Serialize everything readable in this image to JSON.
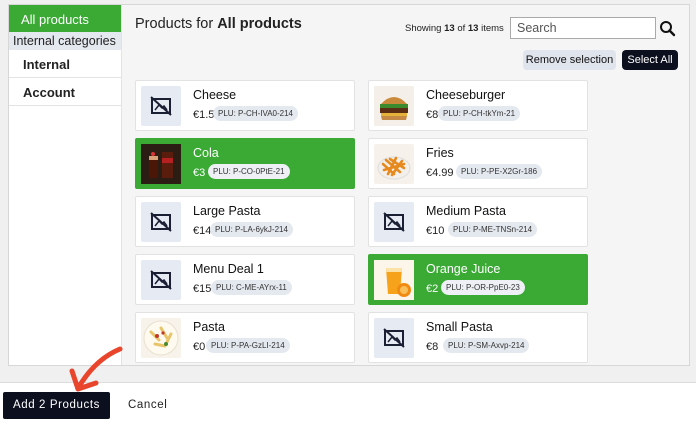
{
  "sidebar": {
    "all_products": "All products",
    "group_label": "Internal categories",
    "items": [
      {
        "label": "Internal"
      },
      {
        "label": "Account"
      }
    ]
  },
  "header": {
    "title_prefix": "Products for",
    "title_bold": "All products",
    "showing_prefix": "Showing",
    "showing_count": "13",
    "showing_of": "of",
    "showing_total": "13",
    "showing_suffix": "items",
    "search_placeholder": "Search",
    "remove_selection": "Remove selection",
    "select_all": "Select All"
  },
  "products": [
    {
      "name": "Cheese",
      "price": "€1.5",
      "plu": "PLU: P-CH-IVA0-214",
      "selected": false,
      "image": "no-image-icon"
    },
    {
      "name": "Cheeseburger",
      "price": "€8",
      "plu": "PLU: P-CH-tkYm-21",
      "selected": false,
      "image": "burger-photo"
    },
    {
      "name": "Cola",
      "price": "€3",
      "plu": "PLU: P-CO-0PtE-21",
      "selected": true,
      "image": "cola-photo"
    },
    {
      "name": "Fries",
      "price": "€4.99",
      "plu": "PLU: P-PE-X2Gr-186",
      "selected": false,
      "image": "fries-photo"
    },
    {
      "name": "Large Pasta",
      "price": "€14",
      "plu": "PLU: P-LA-6ykJ-214",
      "selected": false,
      "image": "no-image-icon"
    },
    {
      "name": "Medium Pasta",
      "price": "€10",
      "plu": "PLU: P-ME-TNSn-214",
      "selected": false,
      "image": "no-image-icon"
    },
    {
      "name": "Menu Deal 1",
      "price": "€15",
      "plu": "PLU: C-ME-AYrx-11",
      "selected": false,
      "image": "no-image-icon"
    },
    {
      "name": "Orange Juice",
      "price": "€2",
      "plu": "PLU: P-OR-PpE0-23",
      "selected": true,
      "image": "orange-juice-photo"
    },
    {
      "name": "Pasta",
      "price": "€0",
      "plu": "PLU: P-PA-GzLI-214",
      "selected": false,
      "image": "pasta-photo"
    },
    {
      "name": "Small Pasta",
      "price": "€8",
      "plu": "PLU: P-SM-Axvp-214",
      "selected": false,
      "image": "no-image-icon"
    }
  ],
  "footer": {
    "add_products": "Add 2 Products",
    "cancel": "Cancel"
  },
  "colors": {
    "accent_green": "#3aaa35",
    "dark_button": "#0c0f1e",
    "annotation_arrow": "#e8452c"
  }
}
